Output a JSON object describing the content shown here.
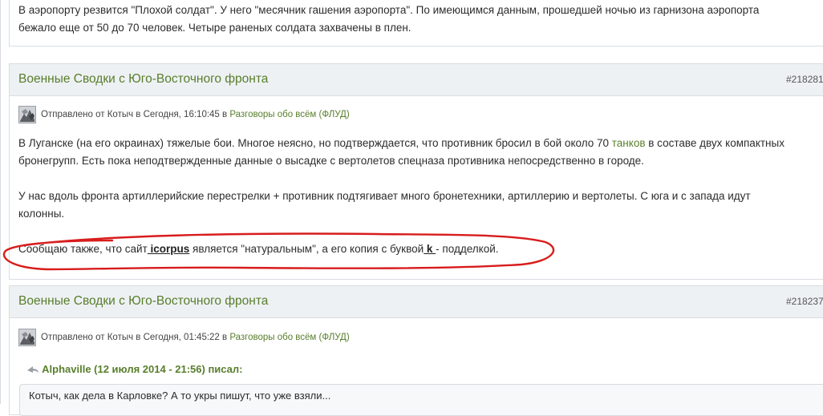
{
  "top_post": {
    "line1": "В аэропорту резвится \"Плохой солдат\". У него \"месячник гашения аэропорта\". По имеющимся данным, прошедшей ночью из гарнизона аэропорта",
    "line2": "бежало еще от 50 до 70 человек. Четыре раненых солдата захвачены в плен."
  },
  "post1": {
    "title": "Военные Сводки с Юго-Восточного фронта",
    "id": "#218281",
    "meta_prefix": "Отправлено от Котыч в Сегодня, 16:10:45 в ",
    "forum": "Разговоры обо всём (ФЛУД)",
    "p1_line1_a": "В Луганске (на его окраинах) тяжелые бои. Многое неясно, но подтверждается, что противник бросил в бой около 70 ",
    "p1_link": "танков",
    "p1_line1_b": " в составе двух компактных",
    "p1_line2": "бронегрупп. Есть пока неподтвержденные данные о высадке с вертолетов спецназа противника непосредственно в городе.",
    "p2_line1": "У нас вдоль фронта артиллерийские перестрелки + противник подтягивает много бронетехники, артиллерию и вертолеты. С юга и с запада идут",
    "p2_line2": "колонны.",
    "p3_a": "Сообщаю также, что сайт",
    "p3_link1": " icorpus",
    "p3_b": "  является \"натуральным\", а его копия с буквой",
    "p3_link2": " k ",
    "p3_c": "- подделкой."
  },
  "post2": {
    "title": "Военные Сводки с Юго-Восточного фронта",
    "id": "#218237",
    "meta_prefix": "Отправлено от Котыч в Сегодня, 01:45:22 в ",
    "forum": "Разговоры обо всём (ФЛУД)",
    "quote_author": "Alphaville (12 июля 2014 - 21:56) писал:",
    "quote_text": "Котыч, как дела в Карловке? А то укры пишут, что уже взяли..."
  },
  "colors": {
    "accent": "#587e2b",
    "annotation": "#d81c1c"
  },
  "icons": {
    "avatar": "avatar-image",
    "quote": "quote-arrow-icon"
  }
}
